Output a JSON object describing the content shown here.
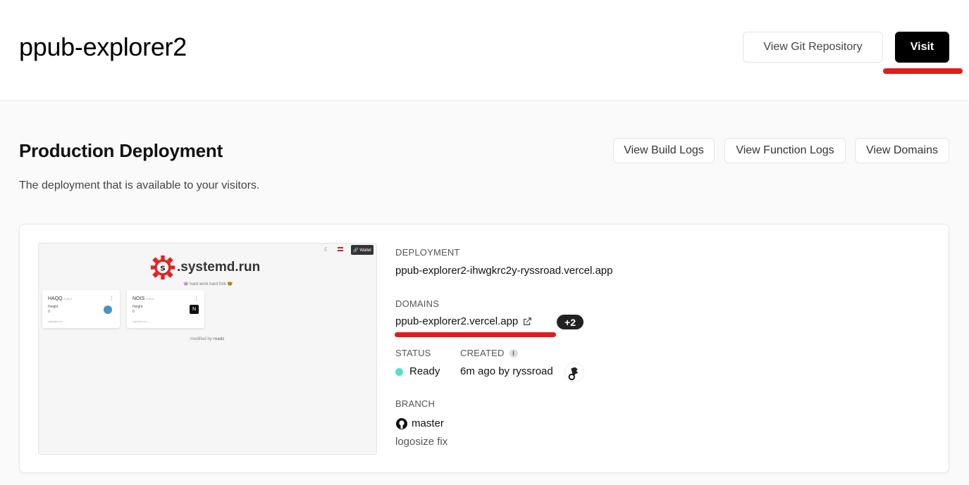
{
  "header": {
    "title": "ppub-explorer2",
    "git_button": "View Git Repository",
    "visit_button": "Visit"
  },
  "production": {
    "title": "Production Deployment",
    "subtitle": "The deployment that is available to your visitors.",
    "buttons": {
      "build_logs": "View Build Logs",
      "function_logs": "View Function Logs",
      "domains": "View Domains"
    }
  },
  "preview": {
    "logo_text": ".systemd.run",
    "tagline": "👾 hard work hard fork 🤓",
    "wallet": "🔗 Wallet",
    "tiles": [
      {
        "name": "HAQQ",
        "version": "0.49.0",
        "meta_label": "Height",
        "meta_value": "0",
        "footer": "Updated on ..."
      },
      {
        "name": "NOIS",
        "version": "0.49.0",
        "meta_label": "Height",
        "meta_value": "0",
        "footer": "Updated on ..."
      }
    ],
    "modified": "modified by",
    "modified_by": "roadz"
  },
  "details": {
    "deployment_label": "DEPLOYMENT",
    "deployment_url": "ppub-explorer2-ihwgkrc2y-ryssroad.vercel.app",
    "domains_label": "DOMAINS",
    "domain": "ppub-explorer2.vercel.app",
    "domain_extra": "+2",
    "status_label": "STATUS",
    "status": "Ready",
    "status_color": "#50e3c2",
    "created_label": "CREATED",
    "created": "6m ago by ryssroad",
    "branch_label": "BRANCH",
    "branch": "master",
    "commit": "logosize fix"
  },
  "colors": {
    "accent": "#000000",
    "annotation": "#e21b1b"
  }
}
